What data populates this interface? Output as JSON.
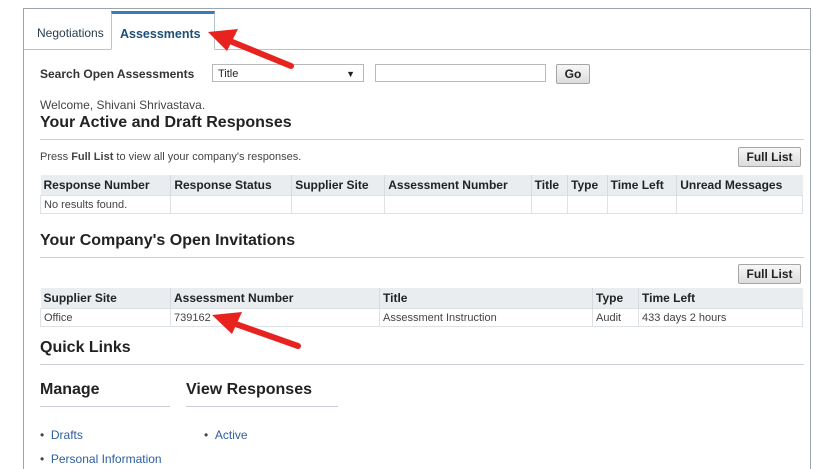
{
  "tabs": [
    {
      "label": "Negotiations",
      "active": false
    },
    {
      "label": "Assessments",
      "active": true
    }
  ],
  "search": {
    "label": "Search Open Assessments",
    "field_value": "Title",
    "text_value": "",
    "go_label": "Go"
  },
  "welcome": "Welcome, Shivani Shrivastava.",
  "active_responses": {
    "heading": "Your Active and Draft Responses",
    "instruction_prefix": "Press ",
    "instruction_bold": "Full List",
    "instruction_suffix": " to view all your company's responses.",
    "full_list_label": "Full List",
    "columns": [
      "Response Number",
      "Response Status",
      "Supplier Site",
      "Assessment Number",
      "Title",
      "Type",
      "Time Left",
      "Unread Messages"
    ],
    "empty_text": "No results found."
  },
  "open_invitations": {
    "heading": "Your Company's Open Invitations",
    "full_list_label": "Full List",
    "columns": [
      "Supplier Site",
      "Assessment Number",
      "Title",
      "Type",
      "Time Left"
    ],
    "rows": [
      {
        "supplier_site": "Office",
        "assessment_number": "739162",
        "title": "Assessment Instruction",
        "type": "Audit",
        "time_left": "433 days 2 hours"
      }
    ]
  },
  "quick_links": {
    "heading": "Quick Links",
    "manage": {
      "heading": "Manage",
      "items": [
        "Drafts",
        "Personal Information"
      ]
    },
    "view_responses": {
      "heading": "View Responses",
      "items": [
        "Active"
      ]
    }
  },
  "colors": {
    "annotation_arrow": "#e8231f",
    "link": "#2d5f9e",
    "tab_accent": "#3a7bbf"
  },
  "icons": {
    "select_caret": "chevron-down-icon",
    "annotation": "red-arrow-icon"
  }
}
